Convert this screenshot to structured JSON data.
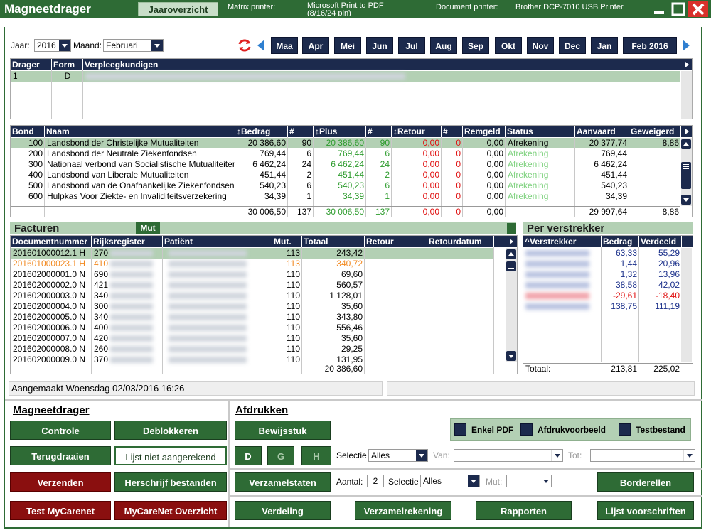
{
  "titlebar": {
    "app_title": "Magneetdrager",
    "view_button": "Jaaroverzicht",
    "matrix_label": "Matrix printer:",
    "matrix_value": "Microsoft Print to PDF (8/16/24 pin)",
    "document_label": "Document printer:",
    "document_value": "Brother DCP-7010 USB Printer"
  },
  "filters": {
    "jaar_label": "Jaar:",
    "jaar_value": "2016",
    "maand_label": "Maand:",
    "maand_value": "Februari"
  },
  "months": [
    "Maa",
    "Apr",
    "Mei",
    "Jun",
    "Jul",
    "Aug",
    "Sep",
    "Okt",
    "Nov",
    "Dec",
    "Jan",
    "Feb 2016"
  ],
  "drager_grid": {
    "headers": [
      "Drager",
      "Form",
      "Verpleegkundigen"
    ],
    "rows": [
      {
        "drager": "1",
        "form": "D"
      }
    ]
  },
  "bond_grid": {
    "headers": [
      "Bond",
      "Naam",
      "Bedrag",
      "#",
      "Plus",
      "#",
      "Retour",
      "#",
      "Remgeld",
      "Status",
      "Aanvaard",
      "Geweigerd"
    ],
    "rows": [
      {
        "bond": "100",
        "naam": "Landsbond der Christelijke Mutualiteiten",
        "bedrag": "20 386,60",
        "n1": "90",
        "plus": "20 386,60",
        "n2": "90",
        "retour": "0,00",
        "n3": "0",
        "remgeld": "0,00",
        "status": "Afrekening",
        "aanvaard": "20 377,74",
        "geweigerd": "8,86"
      },
      {
        "bond": "200",
        "naam": "Landsbond der Neutrale Ziekenfondsen",
        "bedrag": "769,44",
        "n1": "6",
        "plus": "769,44",
        "n2": "6",
        "retour": "0,00",
        "n3": "0",
        "remgeld": "0,00",
        "status": "Afrekening",
        "aanvaard": "769,44",
        "geweigerd": ""
      },
      {
        "bond": "300",
        "naam": "Nationaal verbond van Socialistische Mutualiteiten",
        "bedrag": "6 462,24",
        "n1": "24",
        "plus": "6 462,24",
        "n2": "24",
        "retour": "0,00",
        "n3": "0",
        "remgeld": "0,00",
        "status": "Afrekening",
        "aanvaard": "6 462,24",
        "geweigerd": ""
      },
      {
        "bond": "400",
        "naam": "Landsbond van Liberale Mutualiteiten",
        "bedrag": "451,44",
        "n1": "2",
        "plus": "451,44",
        "n2": "2",
        "retour": "0,00",
        "n3": "0",
        "remgeld": "0,00",
        "status": "Afrekening",
        "aanvaard": "451,44",
        "geweigerd": ""
      },
      {
        "bond": "500",
        "naam": "Landsbond van de Onafhankelijke Ziekenfondsen",
        "bedrag": "540,23",
        "n1": "6",
        "plus": "540,23",
        "n2": "6",
        "retour": "0,00",
        "n3": "0",
        "remgeld": "0,00",
        "status": "Afrekening",
        "aanvaard": "540,23",
        "geweigerd": ""
      },
      {
        "bond": "600",
        "naam": "Hulpkas Voor Ziekte- en Invaliditeitsverzekering",
        "bedrag": "34,39",
        "n1": "1",
        "plus": "34,39",
        "n2": "1",
        "retour": "0,00",
        "n3": "0",
        "remgeld": "0,00",
        "status": "Afrekening",
        "aanvaard": "34,39",
        "geweigerd": ""
      }
    ],
    "totals": {
      "bedrag": "30 006,50",
      "n1": "137",
      "plus": "30 006,50",
      "n2": "137",
      "retour": "0,00",
      "n3": "0",
      "remgeld": "0,00",
      "aanvaard": "29 997,64",
      "geweigerd": "8,86"
    }
  },
  "facturen": {
    "title": "Facturen",
    "mut_tag": "Mut",
    "headers": [
      "Documentnummer",
      "Rijksregister",
      "Patiënt",
      "Mut.",
      "Totaal",
      "Retour",
      "Retourdatum"
    ],
    "rows": [
      {
        "doc": "201601000012.1 H",
        "rr": "270",
        "mut": "113",
        "totaal": "243,42",
        "style": "sel"
      },
      {
        "doc": "201601000023.1 H",
        "rr": "410",
        "mut": "113",
        "totaal": "340,72",
        "style": "orange"
      },
      {
        "doc": "201602000001.0 N",
        "rr": "690",
        "mut": "110",
        "totaal": "69,60",
        "style": ""
      },
      {
        "doc": "201602000002.0 N",
        "rr": "421",
        "mut": "110",
        "totaal": "560,57",
        "style": ""
      },
      {
        "doc": "201602000003.0 N",
        "rr": "340",
        "mut": "110",
        "totaal": "1 128,01",
        "style": ""
      },
      {
        "doc": "201602000004.0 N",
        "rr": "300",
        "mut": "110",
        "totaal": "35,60",
        "style": ""
      },
      {
        "doc": "201602000005.0 N",
        "rr": "340",
        "mut": "110",
        "totaal": "343,80",
        "style": ""
      },
      {
        "doc": "201602000006.0 N",
        "rr": "400",
        "mut": "110",
        "totaal": "556,46",
        "style": ""
      },
      {
        "doc": "201602000007.0 N",
        "rr": "420",
        "mut": "110",
        "totaal": "35,60",
        "style": ""
      },
      {
        "doc": "201602000008.0 N",
        "rr": "260",
        "mut": "110",
        "totaal": "29,25",
        "style": ""
      },
      {
        "doc": "201602000009.0 N",
        "rr": "370",
        "mut": "110",
        "totaal": "131,95",
        "style": ""
      }
    ],
    "total": "20 386,60"
  },
  "verstrekker": {
    "title": "Per verstrekker",
    "headers": [
      "^Verstrekker",
      "Bedrag",
      "Verdeeld"
    ],
    "rows": [
      {
        "bedrag": "63,33",
        "verdeeld": "55,29",
        "neg": false
      },
      {
        "bedrag": "1,44",
        "verdeeld": "20,96",
        "neg": false
      },
      {
        "bedrag": "1,32",
        "verdeeld": "13,96",
        "neg": false
      },
      {
        "bedrag": "38,58",
        "verdeeld": "42,02",
        "neg": false
      },
      {
        "bedrag": "-29,61",
        "verdeeld": "-18,40",
        "neg": true
      },
      {
        "bedrag": "138,75",
        "verdeeld": "111,19",
        "neg": false
      }
    ],
    "total_label": "Totaal:",
    "total_bedrag": "213,81",
    "total_verdeeld": "225,02"
  },
  "status": {
    "created": "Aangemaakt Woensdag 02/03/2016 16:26"
  },
  "magneetdrager": {
    "title": "Magneetdrager",
    "controle": "Controle",
    "deblokkeren": "Deblokkeren",
    "terugdraaien": "Terugdraaien",
    "lijst_niet": "Lijst niet aangerekend",
    "verzenden": "Verzenden",
    "herschrijf": "Herschrijf bestanden",
    "test_mycarenet": "Test MyCarenet",
    "mycarenet_overzicht": "MyCareNet Overzicht"
  },
  "afdrukken": {
    "title": "Afdrukken",
    "bewijsstuk": "Bewijsstuk",
    "enkel_pdf": "Enkel PDF",
    "afdrukvoorbeeld": "Afdrukvoorbeeld",
    "testbestand": "Testbestand",
    "btn_d": "D",
    "btn_g": "G",
    "btn_h": "H",
    "selectie_label": "Selectie",
    "selectie_value": "Alles",
    "van_label": "Van:",
    "tot_label": "Tot:",
    "verzamelstaten": "Verzamelstaten",
    "aantal_label": "Aantal:",
    "aantal_value": "2",
    "selectie2_label": "Selectie",
    "selectie2_value": "Alles",
    "mut_label": "Mut:",
    "borderellen": "Borderellen",
    "verdeling": "Verdeling",
    "verzamelrekening": "Verzamelrekening",
    "rapporten": "Rapporten",
    "lijst_voorschriften": "Lijst voorschriften"
  }
}
